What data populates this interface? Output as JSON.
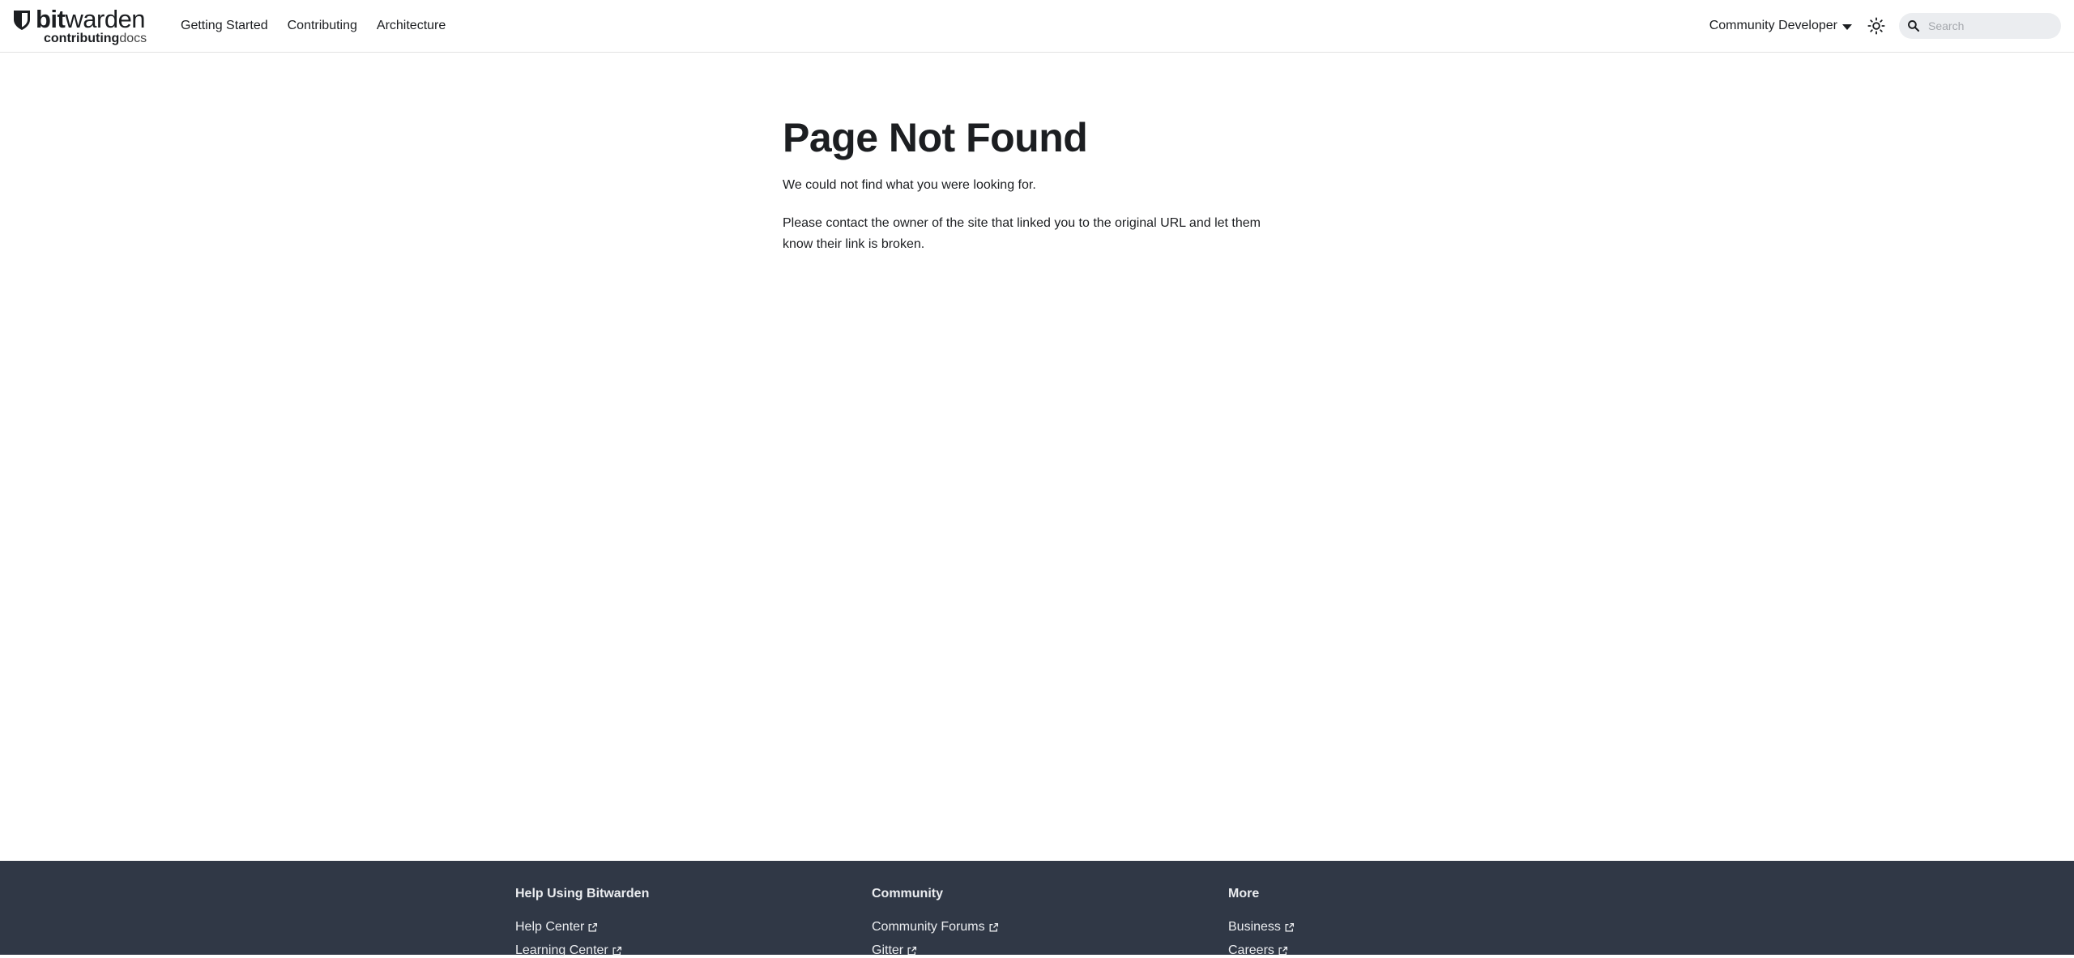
{
  "brand": {
    "top_bold": "bit",
    "top_regular": "warden",
    "bottom_bold": "contributing",
    "bottom_regular": "docs"
  },
  "nav": {
    "items": [
      {
        "label": "Getting Started"
      },
      {
        "label": "Contributing"
      },
      {
        "label": "Architecture"
      }
    ],
    "dropdown_label": "Community Developer",
    "search_placeholder": "Search"
  },
  "icons": {
    "logo": "shield-icon",
    "theme": "sun-icon",
    "search": "search-icon",
    "dropdown": "caret-down-icon",
    "external": "external-link-icon"
  },
  "main": {
    "title": "Page Not Found",
    "paragraph1": "We could not find what you were looking for.",
    "paragraph2": "Please contact the owner of the site that linked you to the original URL and let them know their link is broken."
  },
  "footer": {
    "columns": [
      {
        "title": "Help Using Bitwarden",
        "links": [
          {
            "label": "Help Center"
          },
          {
            "label": "Learning Center"
          }
        ]
      },
      {
        "title": "Community",
        "links": [
          {
            "label": "Community Forums"
          },
          {
            "label": "Gitter"
          }
        ]
      },
      {
        "title": "More",
        "links": [
          {
            "label": "Business"
          },
          {
            "label": "Careers"
          }
        ]
      }
    ]
  },
  "colors": {
    "footer_bg": "#303846",
    "text": "#1c1e21",
    "search_bg": "#ebedf0"
  }
}
